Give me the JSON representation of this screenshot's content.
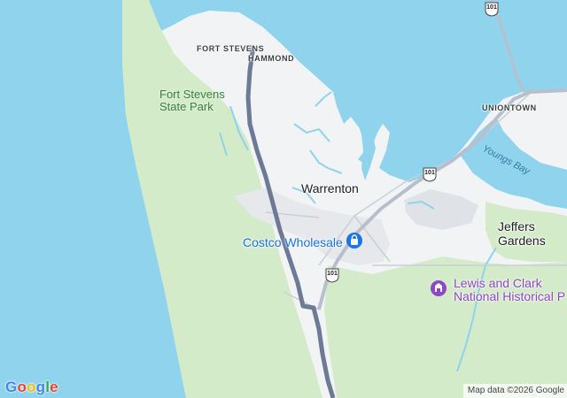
{
  "map": {
    "colors": {
      "water": "#8fd3ec",
      "land": "#f1f3f4",
      "park": "#d4ebc9",
      "highway": "#6d7a95",
      "road": "#b8bfcc",
      "poi_blue": "#1a73e8",
      "poi_purple": "#8e47c5"
    },
    "labels": {
      "fort_stevens": "FORT STEVENS",
      "hammond": "HAMMOND",
      "uniontown": "UNIONTOWN",
      "warrenton": "Warrenton",
      "jeffers_gardens": "Jeffers\nGardens",
      "state_park": "Fort Stevens\nState Park",
      "youngs_bay": "Youngs Bay"
    },
    "pois": {
      "costco": {
        "name": "Costco Wholesale",
        "icon": "shopping-bag-icon"
      },
      "lewis_clark": {
        "name": "Lewis and Clark\nNational Historical P",
        "icon": "monument-icon"
      }
    },
    "shields": [
      {
        "route": "101"
      },
      {
        "route": "101"
      },
      {
        "route": "101"
      }
    ],
    "footer": {
      "logo": "Google",
      "attribution": "Map data ©2026 Google"
    }
  }
}
